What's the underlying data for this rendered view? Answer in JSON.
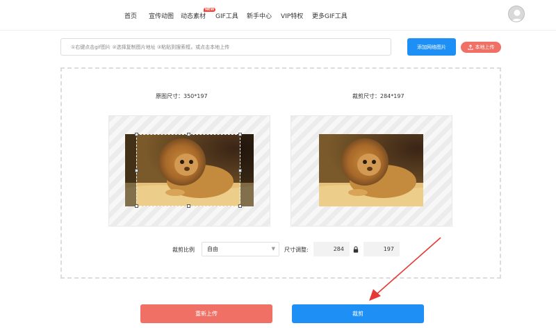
{
  "nav": {
    "items": [
      "首页",
      "宣传动图",
      "动态素材",
      "GIF工具",
      "新手中心",
      "VIP特权",
      "更多GIF工具"
    ],
    "badge": "NEW"
  },
  "url_bar": {
    "placeholder": "①右键点击gif图片 ②选择复制图片地址 ③粘贴到搜索框，或点击本地上传",
    "add_button": "添加网络图片",
    "local_button": "本地上传"
  },
  "editor": {
    "original_size_label": "原图尺寸：350*197",
    "crop_size_label": "裁剪尺寸：284*197"
  },
  "controls": {
    "ratio_label": "裁剪比例",
    "ratio_value": "自由",
    "resize_label": "尺寸调整:",
    "width": "284",
    "height": "197"
  },
  "actions": {
    "reupload": "重新上传",
    "crop": "裁剪"
  },
  "colors": {
    "primary": "#1e90f5",
    "secondary": "#f07065",
    "annotation": "#e53935"
  },
  "icons": [
    "avatar-icon",
    "upload-icon",
    "lock-icon",
    "chevron-down-icon"
  ]
}
